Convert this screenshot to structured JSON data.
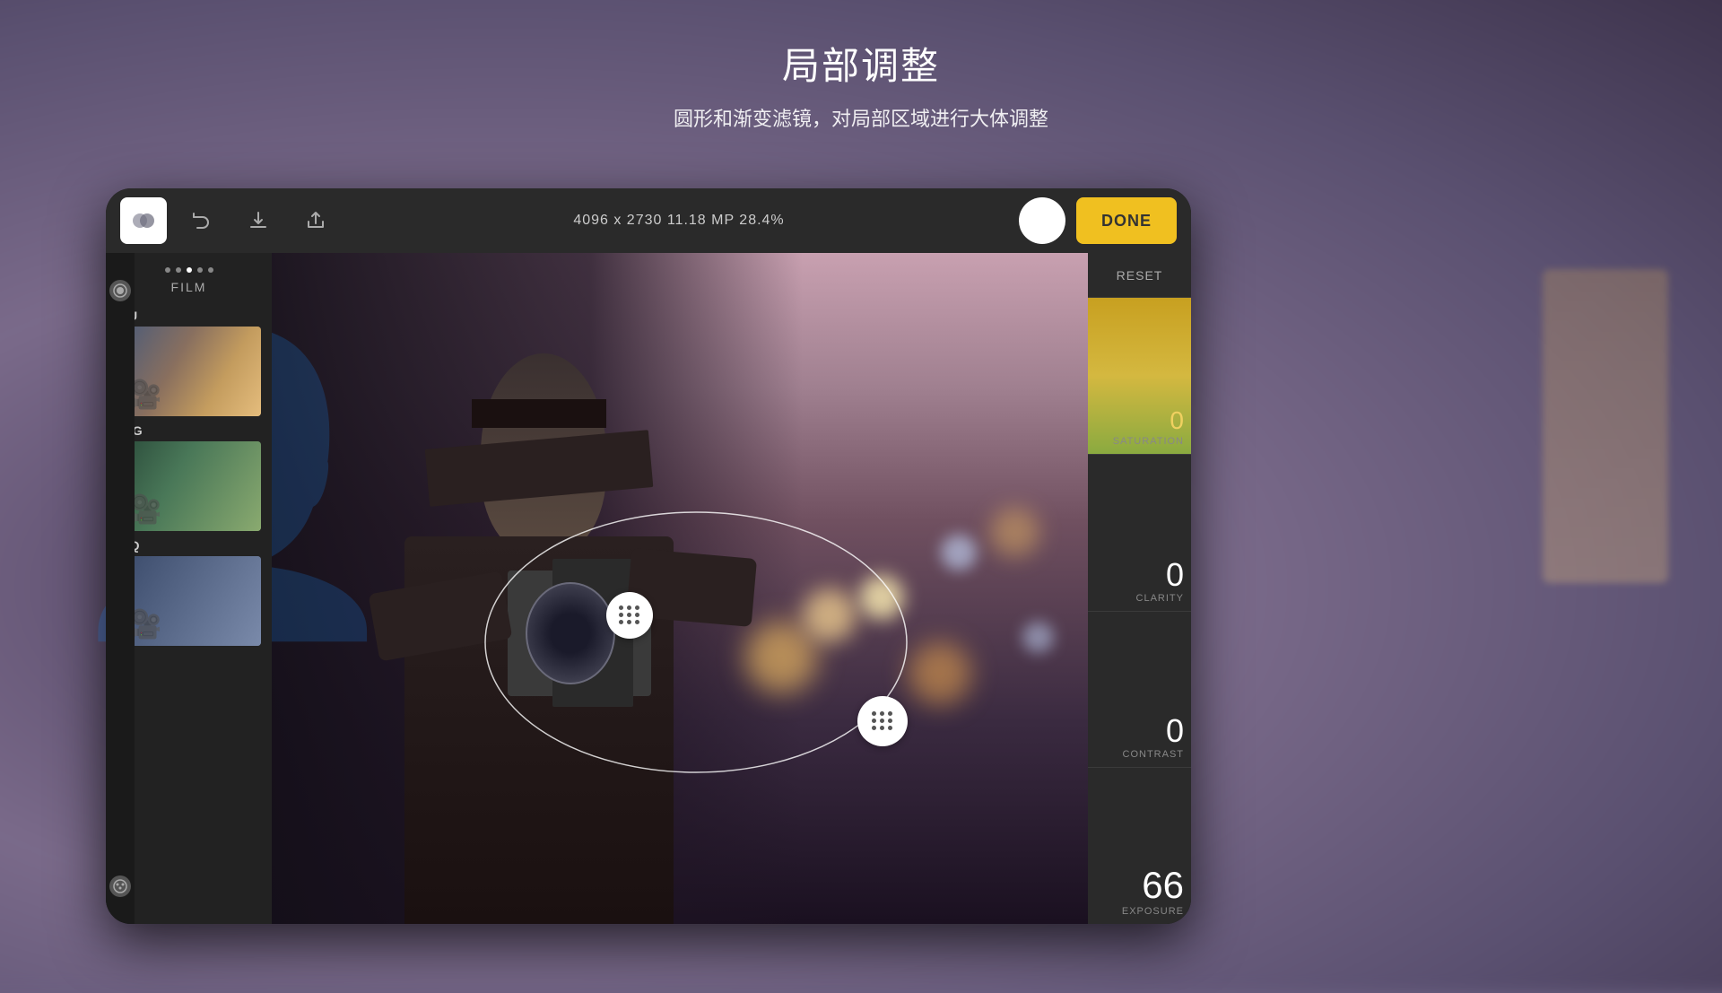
{
  "title": "局部调整",
  "subtitle": "圆形和渐变滤镜，对局部区域进行大体调整",
  "toolbar": {
    "image_info": "4096 x 2730   11.18 MP   28.4%",
    "done_label": "DONE"
  },
  "sidebar": {
    "dots": [
      1,
      2,
      3,
      4,
      5
    ],
    "label": "FILM",
    "items": [
      {
        "id": "LU",
        "label": "LU"
      },
      {
        "id": "WG",
        "label": "WG"
      },
      {
        "id": "AQ",
        "label": "AQ"
      }
    ]
  },
  "right_panel": {
    "reset_label": "RESET",
    "adjustments": [
      {
        "id": "saturation",
        "label": "SATURATION",
        "value": "0"
      },
      {
        "id": "clarity",
        "label": "CLARITY",
        "value": "0"
      },
      {
        "id": "contrast",
        "label": "CONTRAST",
        "value": "0"
      },
      {
        "id": "exposure",
        "label": "EXPOSURE",
        "value": "66"
      }
    ]
  },
  "colors": {
    "accent_yellow": "#f0c020",
    "bg_dark": "#2a2a2a",
    "text_light": "#ffffff"
  }
}
